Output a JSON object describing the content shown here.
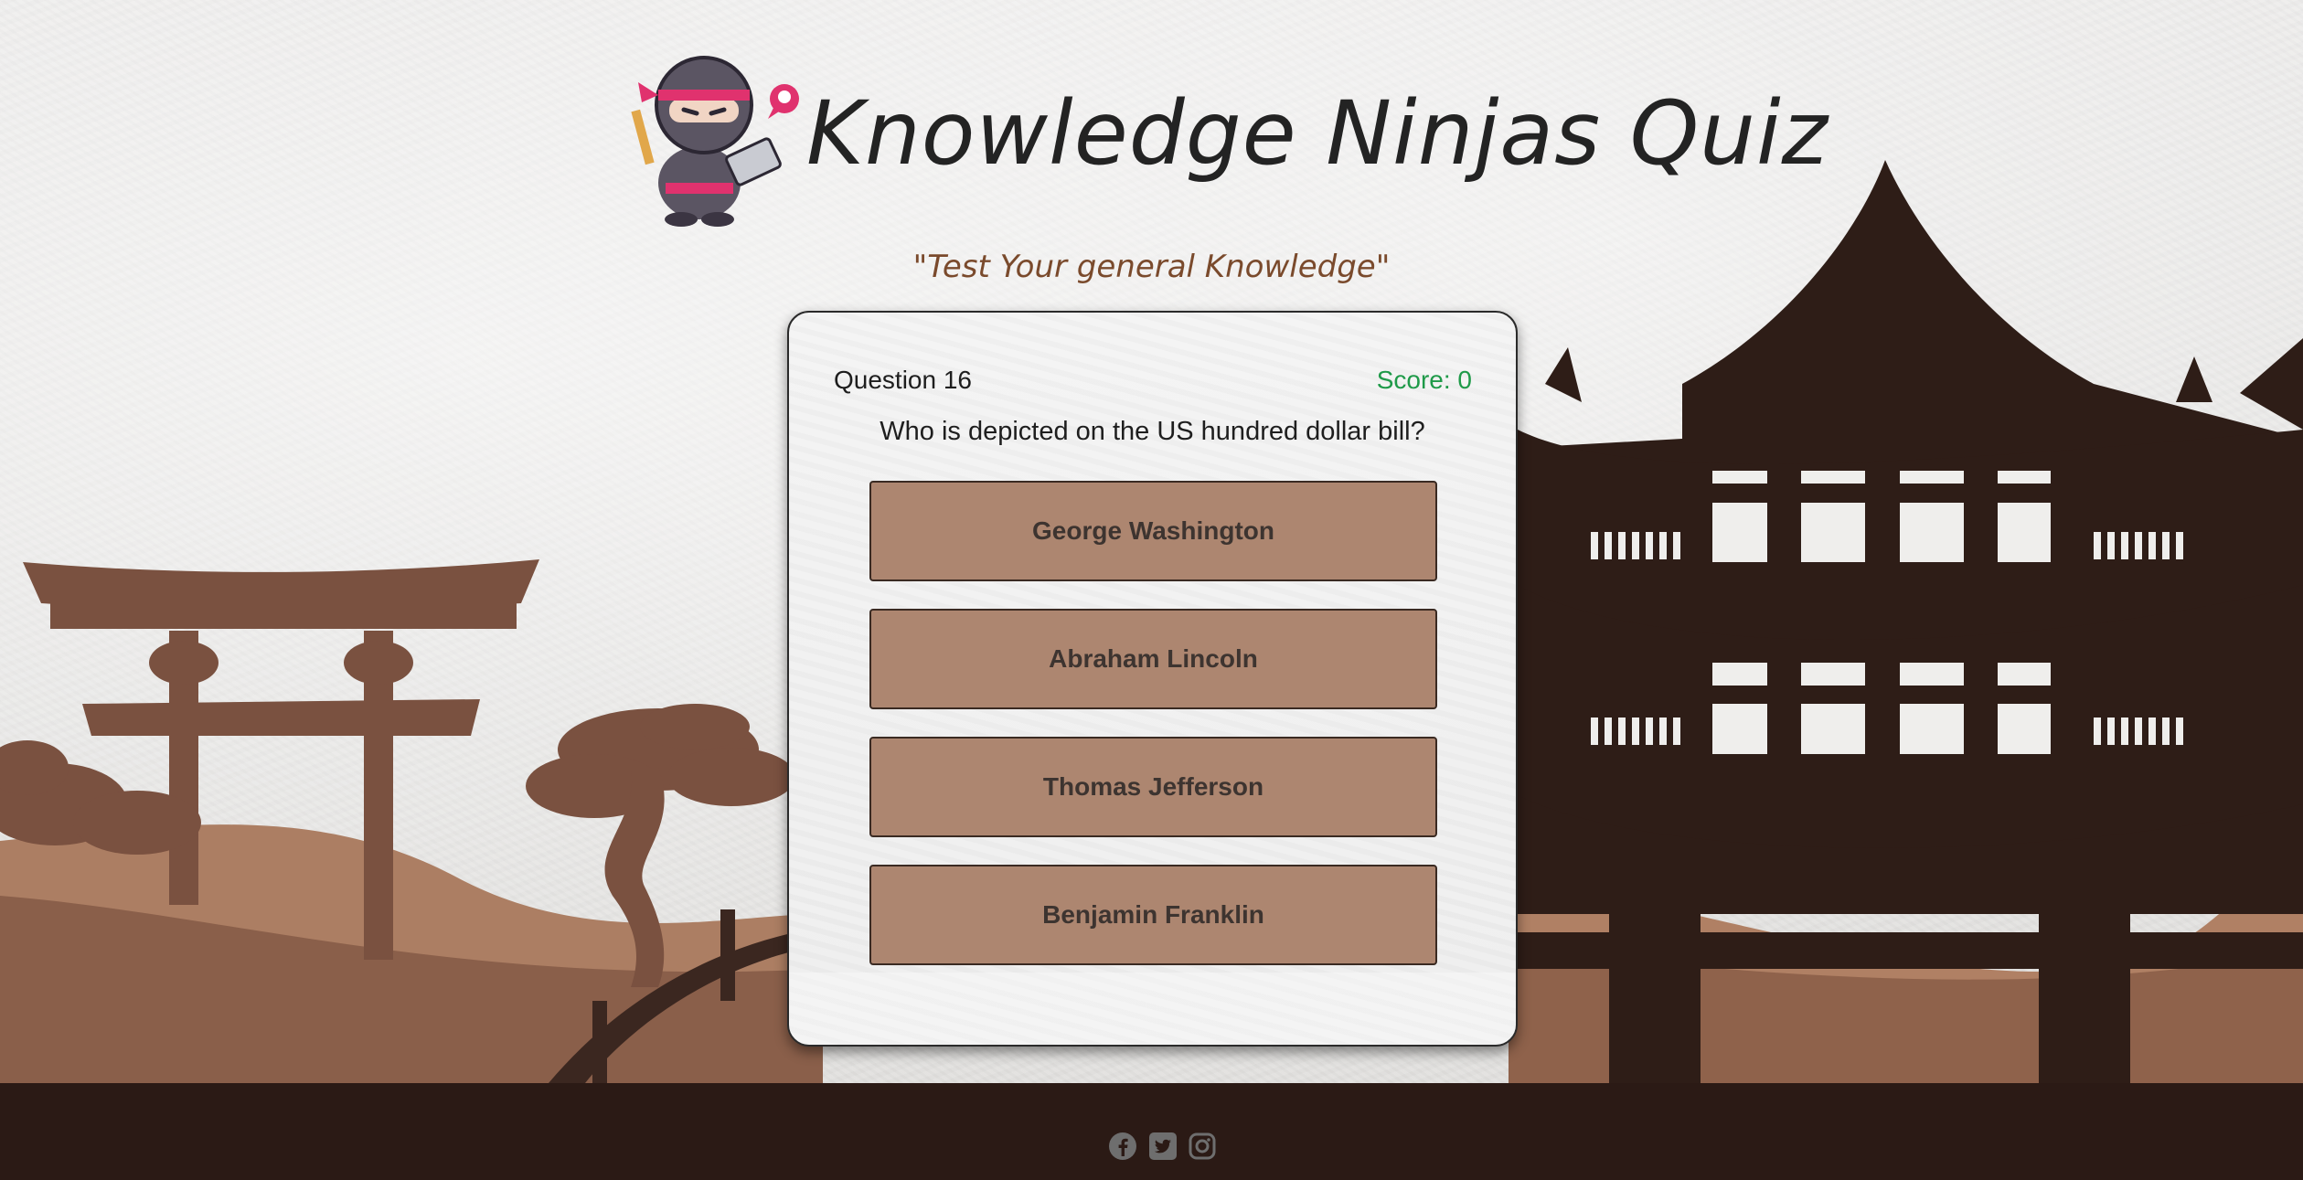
{
  "header": {
    "title": "Knowledge Ninjas Quiz",
    "subtitle": "\"Test Your general Knowledge\""
  },
  "quiz": {
    "question_number": "Question 16",
    "score": "Score: 0",
    "question": "Who is depicted on the US hundred dollar bill?",
    "answers": [
      "George Washington",
      "Abraham Lincoln",
      "Thomas Jefferson",
      "Benjamin Franklin"
    ]
  },
  "footer": {
    "text": "",
    "social": [
      "facebook-icon",
      "twitter-icon",
      "instagram-icon"
    ]
  },
  "colors": {
    "answer_bg": "#ad8670",
    "score": "#1f9a49",
    "subtitle": "#7a4a2c",
    "silhouette_dark": "#2e1d17",
    "silhouette_mid": "#7a5140",
    "hills_light": "#a9785c",
    "footer_bg": "#2b1a15"
  }
}
